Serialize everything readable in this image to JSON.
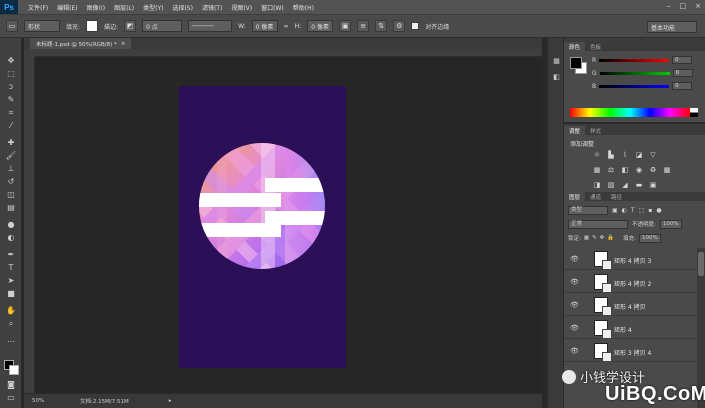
{
  "app": {
    "logo": "Ps"
  },
  "menubar": {
    "items": [
      "文件(F)",
      "编辑(E)",
      "图像(I)",
      "图层(L)",
      "类型(Y)",
      "选择(S)",
      "滤镜(T)",
      "视图(V)",
      "窗口(W)",
      "帮助(H)"
    ],
    "window_controls": [
      "–",
      "□",
      "×"
    ]
  },
  "options": {
    "mode": "形状",
    "fill_label": "填充:",
    "stroke_label": "描边:",
    "stroke_width": "0 点",
    "w_label": "W:",
    "w_value": "0 像素",
    "h_label": "H:",
    "h_value": "0 像素",
    "align_edges_label": "对齐边缘",
    "workspace": "基本功能"
  },
  "document": {
    "tab_title": "未标题-1.psd @ 50%(RGB/8) *",
    "close": "×"
  },
  "statusbar": {
    "zoom": "50%",
    "doc_size": "文档:2.15M/7.51M"
  },
  "color_panel": {
    "tabs": [
      "颜色",
      "色板"
    ],
    "channels": [
      {
        "label": "R",
        "value": "0"
      },
      {
        "label": "G",
        "value": "0"
      },
      {
        "label": "B",
        "value": "0"
      }
    ]
  },
  "adjustments_panel": {
    "tabs": [
      "调整",
      "样式"
    ],
    "title": "添加调整"
  },
  "layers_panel": {
    "tabs": [
      "图层",
      "通道",
      "路径"
    ],
    "filter": "类型",
    "blend_mode": "正常",
    "opacity_label": "不透明度:",
    "opacity_value": "100%",
    "lock_label": "锁定:",
    "fill_label": "填充:",
    "fill_value": "100%",
    "layers": [
      {
        "name": "矩形 4 拷贝 3"
      },
      {
        "name": "矩形 4 拷贝 2"
      },
      {
        "name": "矩形 4 拷贝"
      },
      {
        "name": "矩形 4"
      },
      {
        "name": "矩形 3 拷贝 4"
      }
    ]
  },
  "watermark": {
    "text_cn": "小钱学设计",
    "site": "UiBQ.CoM"
  },
  "colors": {
    "artboard": "#2b1057",
    "accent": "#31a8ff"
  }
}
